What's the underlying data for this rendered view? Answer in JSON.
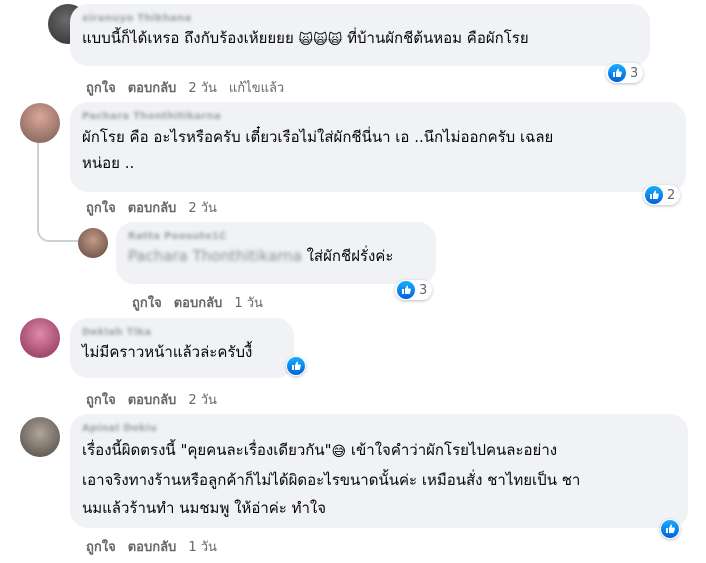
{
  "comments": [
    {
      "author": "xiranuyo Thikhana",
      "lines": [
        "แบบนี้ก็ได้เหรอ ถึงกับร้องเห้ยยยย",
        "ที่บ้านผักชีต้นหอม คือผักโรย"
      ],
      "emoji_icon": "crying-cat-face-icon",
      "emoji_glyph": "🙀🙀🙀",
      "reaction_count": "3",
      "actions": {
        "like": "ถูกใจ",
        "reply": "ตอบกลับ",
        "time": "2 วัน",
        "edited": "แก้ไขแล้ว"
      }
    },
    {
      "author": "Pachara Thonthitikarna",
      "lines": [
        "ผักโรย คือ อะไรหรือครับ เตี๋ยวเรือไม่ใส่ผักชีนี่นา เอ ..นึกไม่ออกครับ เฉลย",
        "หน่อย .."
      ],
      "reaction_count": "2",
      "actions": {
        "like": "ถูกใจ",
        "reply": "ตอบกลับ",
        "time": "2 วัน"
      }
    },
    {
      "author": "Ratta Poosuto1C",
      "mention": "Pachara Thonthitikarna",
      "text": "ใส่ผักชีฝรั่งค่ะ",
      "reaction_count": "3",
      "actions": {
        "like": "ถูกใจ",
        "reply": "ตอบกลับ",
        "time": "1 วัน"
      }
    },
    {
      "author": "Deklah Tika",
      "text": "ไม่มีคราวหน้าแล้วล่ะครับงื้",
      "actions": {
        "like": "ถูกใจ",
        "reply": "ตอบกลับ",
        "time": "2 วัน"
      }
    },
    {
      "author": "Apinal Dokiu",
      "line1_a": "เรื่องนี้ผิดตรงนี้ \"คุยคนละเรื่องเดียวกัน\"",
      "line1_emoji": "😅",
      "line1_b": " เข้าใจคำว่าผักโรยไปคนละอย่าง",
      "line2": "เอาจริงทางร้านหรือลูกค้าก็ไม่ได้ผิดอะไรขนาดนั้นค่ะ เหมือนสั่ง ชาไทยเป็น ชา",
      "line3": "นมแล้วร้านทำ นมชมพู ให้อ่าค่ะ ทำใจ",
      "actions": {
        "like": "ถูกใจ",
        "reply": "ตอบกลับ",
        "time": "1 วัน"
      }
    }
  ],
  "colors": {
    "bubble": "#f0f2f5",
    "like_blue": "#1877f2",
    "meta_gray": "#65676b"
  }
}
